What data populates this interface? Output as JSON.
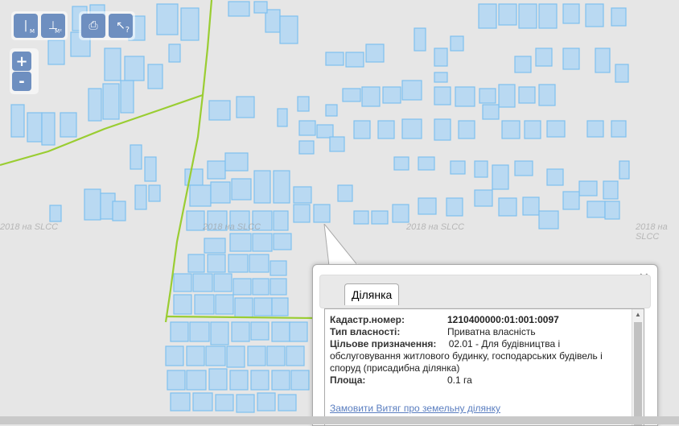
{
  "toolbar": {
    "measure_length_label": "M",
    "measure_area_label": "M²",
    "print_label": "print",
    "identify_label": "?"
  },
  "zoom": {
    "in_label": "+",
    "out_label": "-"
  },
  "watermarks": [
    "2018 на SLCC",
    "2018 на SLCC",
    "2018 на SLCC",
    "2018 на SLCC",
    "2018 на SLCC"
  ],
  "popup": {
    "tab": "Ділянка",
    "fields": [
      {
        "key": "Кадастр.номер:",
        "value": "1210400000:01:001:0097"
      },
      {
        "key": "Тип власності:",
        "value": "Приватна власність"
      },
      {
        "key": "Цільове призначення:",
        "value": "02.01 - Для будівництва і обслуговування житлового будинку, господарських будівель і споруд (присадибна ділянка)"
      },
      {
        "key": "Площа:",
        "value": "0.1 га"
      }
    ],
    "link": "Замовити Витяг про земельну ділянку"
  },
  "colors": {
    "parcel_fill": "#b9d9f2",
    "parcel_stroke": "#7ec0ee",
    "boundary": "#9acd32",
    "map_bg": "#e6e6e6"
  }
}
